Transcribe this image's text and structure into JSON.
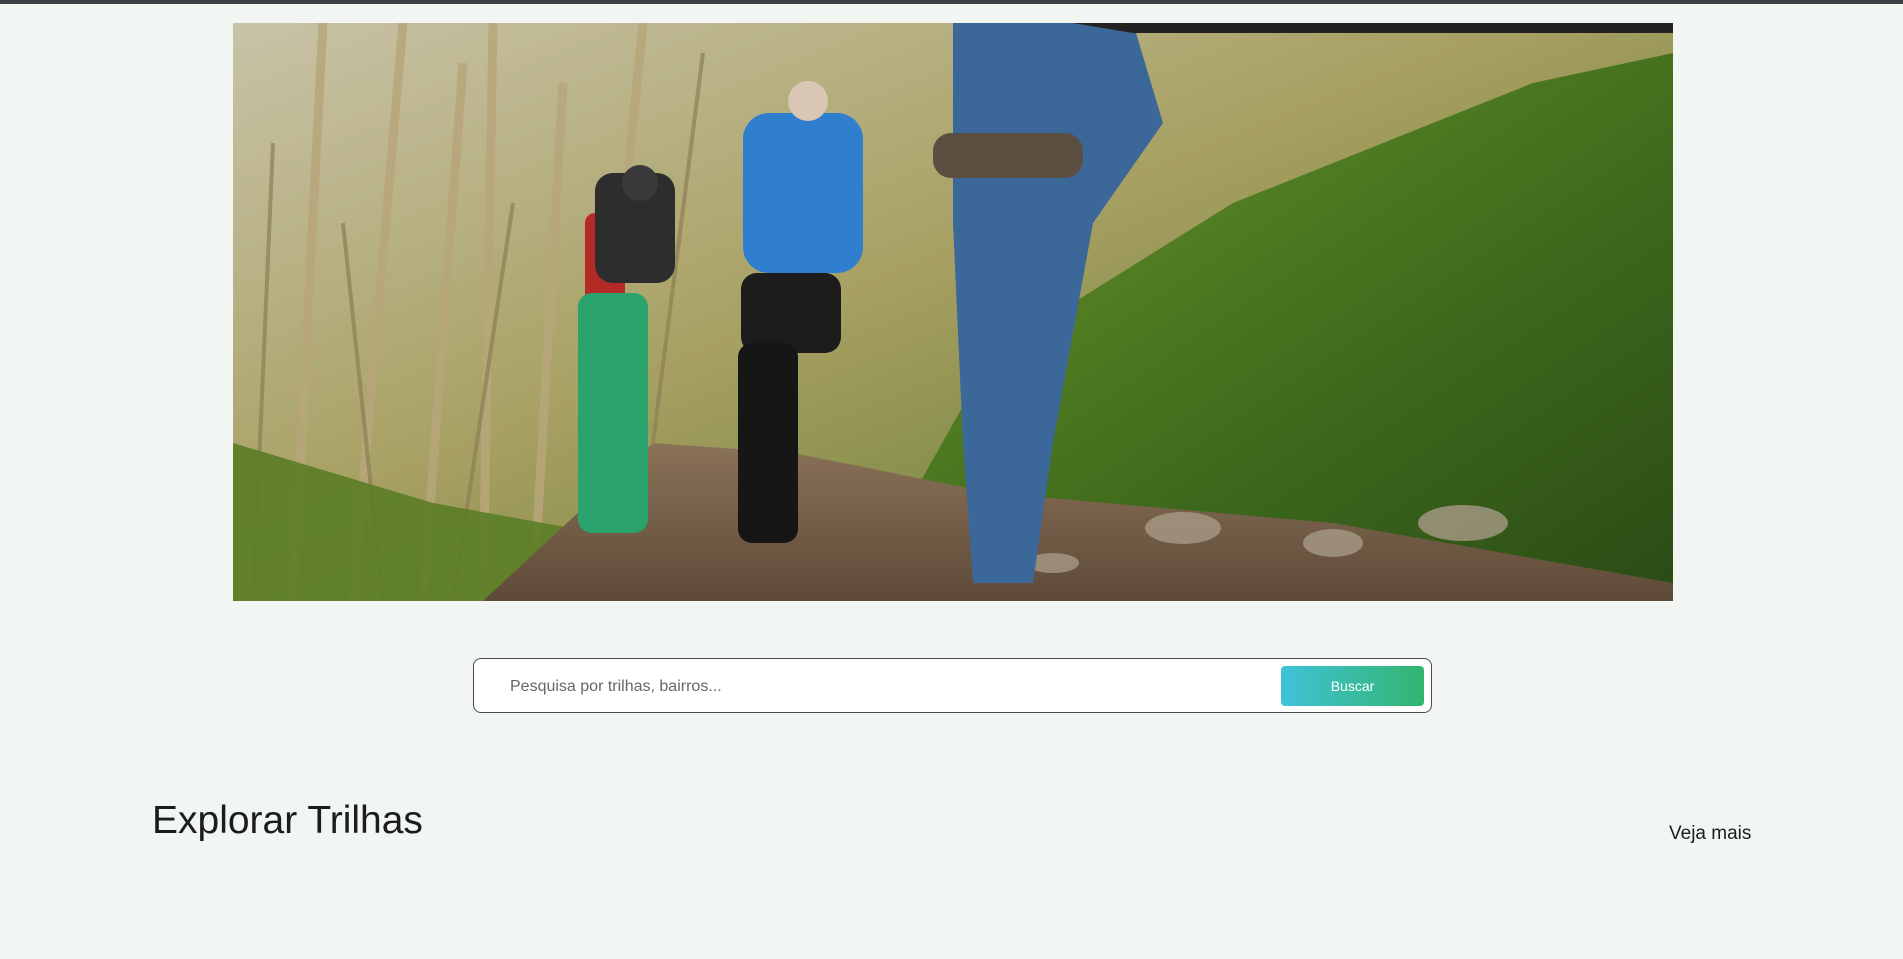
{
  "hero": {
    "image_name": "hikers-on-forest-trail-photo"
  },
  "search": {
    "placeholder": "Pesquisa por trilhas, bairros...",
    "value": "",
    "button_label": "Buscar"
  },
  "section": {
    "title": "Explorar Trilhas",
    "see_more_label": "Veja mais"
  },
  "colors": {
    "page_background": "#f1f6f2",
    "button_gradient_start": "#3fc2d9",
    "button_gradient_end": "#33b56e",
    "top_bar": "#3b3f42"
  }
}
